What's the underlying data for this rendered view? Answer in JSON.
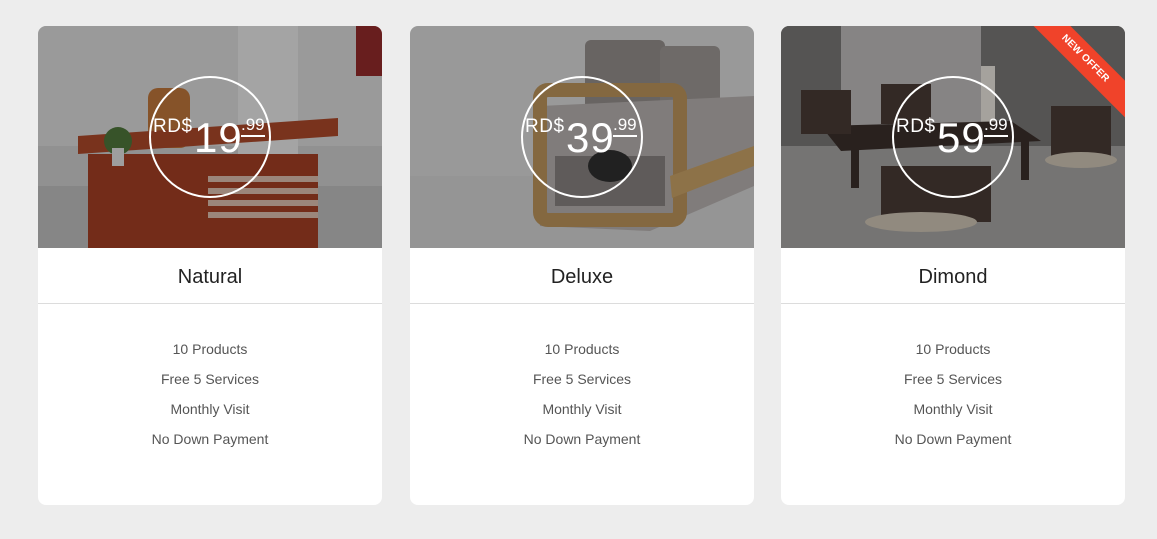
{
  "currency": "RD$",
  "plans": [
    {
      "name": "Natural",
      "price_main": "19",
      "price_cents": ".99",
      "features": [
        "10 Products",
        "Free 5 Services",
        "Monthly Visit",
        "No Down Payment"
      ]
    },
    {
      "name": "Deluxe",
      "price_main": "39",
      "price_cents": ".99",
      "features": [
        "10 Products",
        "Free 5 Services",
        "Monthly Visit",
        "No Down Payment"
      ]
    },
    {
      "name": "Dimond",
      "price_main": "59",
      "price_cents": ".99",
      "features": [
        "10 Products",
        "Free 5 Services",
        "Monthly Visit",
        "No Down Payment"
      ],
      "badge": "NEW OFFER"
    }
  ],
  "colors": {
    "page_background": "#ededed",
    "card_background": "#ffffff",
    "ribbon": "#f0432a",
    "text_dark": "#222222",
    "text_muted": "#555555"
  }
}
